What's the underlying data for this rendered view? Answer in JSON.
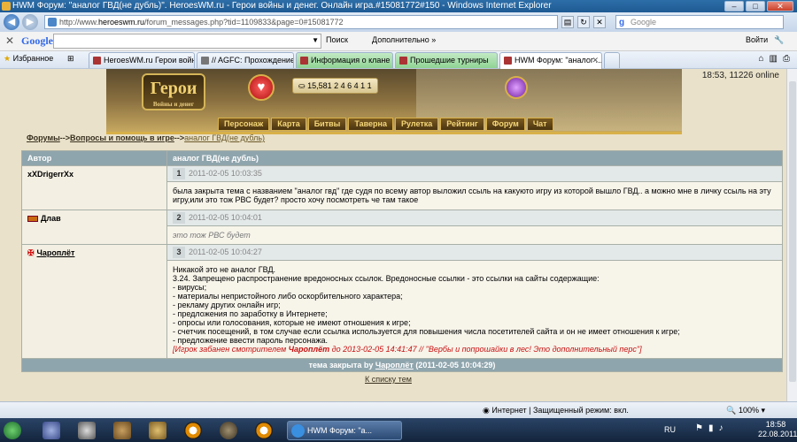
{
  "window": {
    "title": "HWM Форум: \"аналог ГВД(не дубль)\". HeroesWM.ru - Герои войны и денег. Онлайн игра.#15081772#150 - Windows Internet Explorer"
  },
  "address": {
    "prefix": "http://www.",
    "host": "heroeswm.ru",
    "path": "/forum_messages.php?tid=1109833&page=0#15081772"
  },
  "search": {
    "placeholder": "Google"
  },
  "google_toolbar": {
    "close": "✕",
    "logo": "Google",
    "search_btn": "Поиск",
    "more": "Дополнительно »",
    "login": "Войти"
  },
  "favorites": {
    "label": "Избранное"
  },
  "tabs": [
    {
      "label": "HeroesWM.ru Герои войн..."
    },
    {
      "label": "// AGFC: Прохождение ка..."
    },
    {
      "label": "Информация о клане"
    },
    {
      "label": "Прошедшие турниры"
    },
    {
      "label": "HWM Форум: \"аналог ..."
    }
  ],
  "game": {
    "logo_main": "Герои",
    "logo_sub": "Войны и денег",
    "resources": "15,581  2  4  6  4  1  1",
    "time_online": "18:53, 11226 online",
    "menu": [
      "Персонаж",
      "Карта",
      "Битвы",
      "Таверна",
      "Рулетка",
      "Рейтинг",
      "Форум",
      "Чат"
    ]
  },
  "breadcrumb": {
    "forums": "Форумы",
    "sep1": "-->",
    "section": "Вопросы и помощь в игре",
    "sep2": "-->",
    "topic": "аналог ГВД(не дубль)"
  },
  "table": {
    "col_author": "Автор",
    "col_topic": "аналог ГВД(не дубль)"
  },
  "posts": [
    {
      "author": "xXDrigerrXx",
      "num": "1",
      "date": "2011-02-05 10:03:35",
      "text": "была закрыта тема с названием \"аналог гвд\" где судя по всему автор выложил ссыль на какуюто игру из которой вышло ГВД.. а можно мне в личку ссыль на эту игру,или это тож РВС будет? просто хочу посмотреть че там такое"
    },
    {
      "author": "Длав",
      "num": "2",
      "date": "2011-02-05 10:04:01",
      "text": "это тож РВС будет"
    },
    {
      "author": "Чароплёт",
      "num": "3",
      "date": "2011-02-05 10:04:27",
      "lines": [
        "Никакой это не аналог ГВД.",
        "3.24. Запрещено распространение вредоносных ссылок. Вредоносные ссылки - это ссылки на сайты содержащие:",
        "- вирусы;",
        "- материалы непристойного либо оскорбительного характера;",
        "- рекламу других онлайн игр;",
        "- предложения по заработку в Интернете;",
        "- опросы или голосования, которые не имеют отношения к игре;",
        "- счетчик посещений, в том случае если ссылка используется для повышения числа посетителей сайта и он не имеет отношения к игре;",
        "- предложение ввести пароль персонажа."
      ],
      "ban_pre": "[Игрок забанен смотрителем ",
      "ban_name": "Чароплёт",
      "ban_post": " до 2013-02-05 14:41:47 // \"Вербы и попрошайки в лес! Это дополнительный перс\"]"
    }
  ],
  "closed": {
    "pre": "тема закрыта by ",
    "name": "Чароплёт",
    "post": " (2011-02-05 10:04:29)"
  },
  "to_list": "К списку тем",
  "status": {
    "zone": "Интернет | Защищенный режим: вкл.",
    "zoom": "100%"
  },
  "taskbar": {
    "app": "HWM Форум: \"а...",
    "lang": "RU",
    "time": "18:58",
    "date": "22.08.2011"
  }
}
